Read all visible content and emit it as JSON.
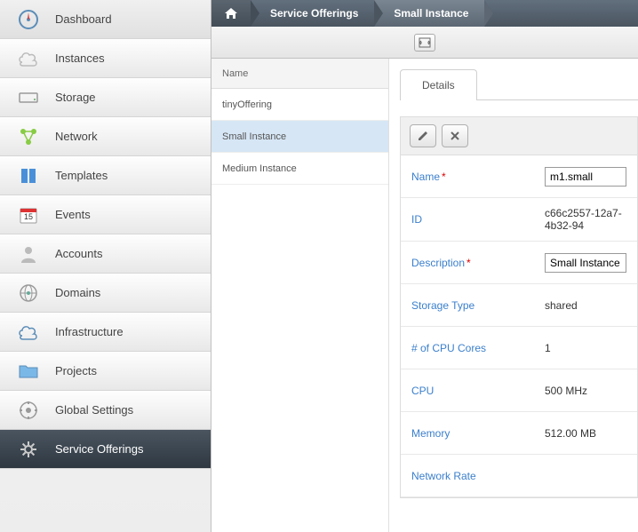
{
  "sidebar": {
    "items": [
      {
        "label": "Dashboard",
        "icon": "compass"
      },
      {
        "label": "Instances",
        "icon": "cloud"
      },
      {
        "label": "Storage",
        "icon": "drive"
      },
      {
        "label": "Network",
        "icon": "network"
      },
      {
        "label": "Templates",
        "icon": "template"
      },
      {
        "label": "Events",
        "icon": "calendar",
        "badge": "15"
      },
      {
        "label": "Accounts",
        "icon": "user"
      },
      {
        "label": "Domains",
        "icon": "globe"
      },
      {
        "label": "Infrastructure",
        "icon": "cloud-infra"
      },
      {
        "label": "Projects",
        "icon": "folder"
      },
      {
        "label": "Global Settings",
        "icon": "gear-globe"
      },
      {
        "label": "Service Offerings",
        "icon": "gear"
      }
    ]
  },
  "breadcrumb": {
    "items": [
      "Service Offerings",
      "Small Instance"
    ]
  },
  "list": {
    "header": "Name",
    "rows": [
      "tinyOffering",
      "Small Instance",
      "Medium Instance"
    ],
    "selected": "Small Instance"
  },
  "details": {
    "tab": "Details",
    "fields": {
      "name_label": "Name",
      "name_value": "m1.small",
      "id_label": "ID",
      "id_value": "c66c2557-12a7-4b32-94",
      "desc_label": "Description",
      "desc_value": "Small Instance",
      "storage_label": "Storage Type",
      "storage_value": "shared",
      "cores_label": "# of CPU Cores",
      "cores_value": "1",
      "cpu_label": "CPU",
      "cpu_value": "500 MHz",
      "mem_label": "Memory",
      "mem_value": "512.00 MB",
      "netrate_label": "Network Rate",
      "netrate_value": ""
    }
  }
}
